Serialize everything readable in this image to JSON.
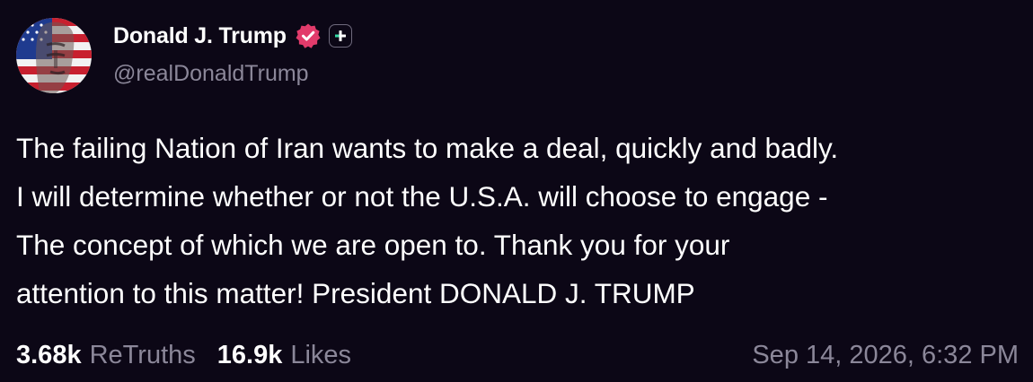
{
  "author": {
    "display_name": "Donald J. Trump",
    "handle": "@realDonaldTrump",
    "avatar_icon": "avatar-portrait-flag",
    "verified_icon": "verified-badge-icon",
    "badge_icon": "plus-badge-icon"
  },
  "post": {
    "lines": [
      "The failing Nation of Iran wants to make a deal, quickly and badly.",
      "I will determine whether or not the U.S.A. will choose to engage -",
      "The concept of which we are open to. Thank you for your",
      "attention to this matter! President DONALD J. TRUMP"
    ]
  },
  "stats": {
    "retruths_count": "3.68k",
    "retruths_label": "ReTruths",
    "likes_count": "16.9k",
    "likes_label": "Likes"
  },
  "timestamp": "Sep 14, 2026, 6:32 PM",
  "colors": {
    "background": "#0c0716",
    "text": "#ffffff",
    "muted": "#8b8799",
    "verified": "#e23b6b",
    "plus_accent": "#35d7a2"
  }
}
